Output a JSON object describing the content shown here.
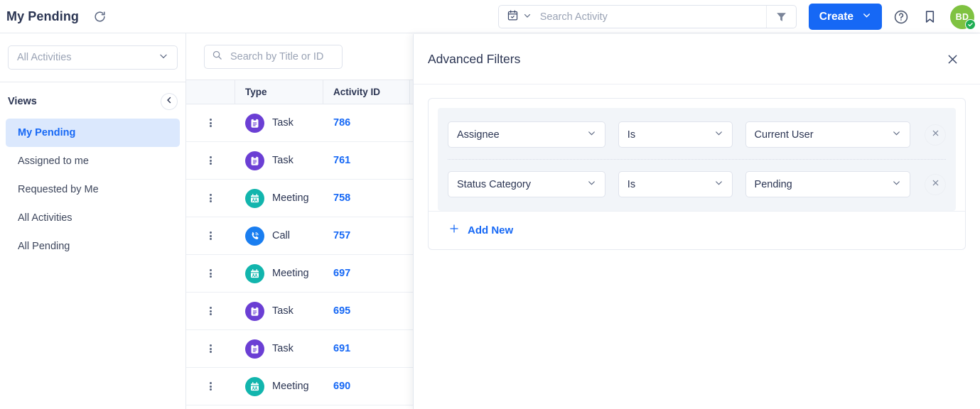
{
  "header": {
    "title": "My Pending",
    "refresh_icon": "refresh-icon",
    "search": {
      "calendar_icon": "calendar-icon",
      "chevron_icon": "chevron-down-icon",
      "placeholder": "Search Activity",
      "value": "",
      "funnel_icon": "filter-funnel-icon"
    },
    "create_label": "Create",
    "create_chevron": "chevron-down-icon",
    "help_icon": "help-circle-icon",
    "bookmark_icon": "bookmark-icon",
    "avatar_initials": "BD",
    "avatar_badge_icon": "check-circle-icon",
    "accent_color": "#1668f5",
    "avatar_color": "#7fc241",
    "avatar_badge_color": "#1fae53"
  },
  "sidebar": {
    "entity_select": {
      "value": "All Activities",
      "chevron_icon": "chevron-down-icon"
    },
    "views_label": "Views",
    "collapse_icon": "chevron-left-icon",
    "items": [
      {
        "label": "My Pending",
        "active": true
      },
      {
        "label": "Assigned to me",
        "active": false
      },
      {
        "label": "Requested by Me",
        "active": false
      },
      {
        "label": "All Activities",
        "active": false
      },
      {
        "label": "All Pending",
        "active": false
      }
    ]
  },
  "table": {
    "search": {
      "placeholder": "Search by Title or ID",
      "value": "",
      "icon": "search-icon"
    },
    "columns": [
      {
        "key": "menu",
        "label": ""
      },
      {
        "key": "type",
        "label": "Type"
      },
      {
        "key": "id",
        "label": "Activity ID"
      },
      {
        "key": "rest",
        "label": ""
      }
    ],
    "rows": [
      {
        "menu_icon": "kebab-menu-icon",
        "type_icon": "task-icon",
        "type": "Task",
        "type_color": "#6b3fd4",
        "id": "786"
      },
      {
        "menu_icon": "kebab-menu-icon",
        "type_icon": "task-icon",
        "type": "Task",
        "type_color": "#6b3fd4",
        "id": "761"
      },
      {
        "menu_icon": "kebab-menu-icon",
        "type_icon": "meeting-icon",
        "type": "Meeting",
        "type_color": "#12b5ad",
        "id": "758"
      },
      {
        "menu_icon": "kebab-menu-icon",
        "type_icon": "call-icon",
        "type": "Call",
        "type_color": "#1a7ef0",
        "id": "757"
      },
      {
        "menu_icon": "kebab-menu-icon",
        "type_icon": "meeting-icon",
        "type": "Meeting",
        "type_color": "#12b5ad",
        "id": "697"
      },
      {
        "menu_icon": "kebab-menu-icon",
        "type_icon": "task-icon",
        "type": "Task",
        "type_color": "#6b3fd4",
        "id": "695"
      },
      {
        "menu_icon": "kebab-menu-icon",
        "type_icon": "task-icon",
        "type": "Task",
        "type_color": "#6b3fd4",
        "id": "691"
      },
      {
        "menu_icon": "kebab-menu-icon",
        "type_icon": "meeting-icon",
        "type": "Meeting",
        "type_color": "#12b5ad",
        "id": "690"
      }
    ]
  },
  "panel": {
    "title": "Advanced Filters",
    "close_icon": "close-icon",
    "chevron_icon": "chevron-down-icon",
    "delete_icon": "close-icon",
    "filters": [
      {
        "field": "Assignee",
        "operator": "Is",
        "value": "Current User"
      },
      {
        "field": "Status Category",
        "operator": "Is",
        "value": "Pending"
      }
    ],
    "add_new_label": "Add New",
    "add_new_icon": "plus-icon"
  }
}
